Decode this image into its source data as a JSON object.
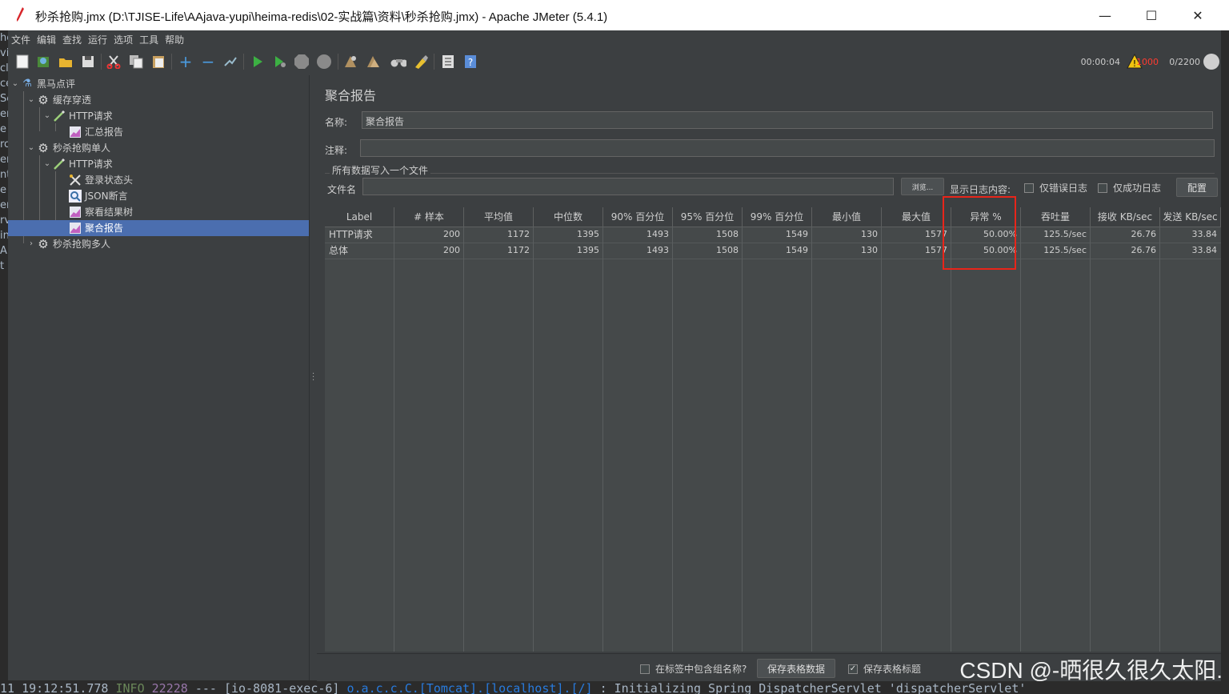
{
  "window": {
    "title": "秒杀抢购.jmx (D:\\TJISE-Life\\AAjava-yupi\\heima-redis\\02-实战篇\\资料\\秒杀抢购.jmx) - Apache JMeter (5.4.1)",
    "minimize": "—",
    "maximize": "☐",
    "close": "✕"
  },
  "menu": [
    "文件",
    "编辑",
    "查找",
    "运行",
    "选项",
    "工具",
    "帮助"
  ],
  "status": {
    "timer": "00:00:04",
    "errors": "1000",
    "threads": "0/2200"
  },
  "tree": {
    "items": [
      {
        "label": "黑马点评"
      },
      {
        "label": "缓存穿透"
      },
      {
        "label": "HTTP请求"
      },
      {
        "label": "汇总报告"
      },
      {
        "label": "秒杀抢购单人"
      },
      {
        "label": "HTTP请求"
      },
      {
        "label": "登录状态头"
      },
      {
        "label": "JSON断言"
      },
      {
        "label": "察看结果树"
      },
      {
        "label": "聚合报告"
      },
      {
        "label": "秒杀抢购多人"
      }
    ]
  },
  "panel": {
    "title": "聚合报告",
    "name_label": "名称:",
    "name_value": "聚合报告",
    "comment_label": "注释:",
    "comment_value": "",
    "file_group": "所有数据写入一个文件",
    "file_label": "文件名",
    "file_value": "",
    "browse": "浏览...",
    "log_label": "显示日志内容:",
    "only_errors": "仅错误日志",
    "only_success": "仅成功日志",
    "config": "配置"
  },
  "table": {
    "headers": [
      "Label",
      "# 样本",
      "平均值",
      "中位数",
      "90% 百分位",
      "95% 百分位",
      "99% 百分位",
      "最小值",
      "最大值",
      "异常 %",
      "吞吐量",
      "接收 KB/sec",
      "发送 KB/sec"
    ],
    "rows": [
      [
        "HTTP请求",
        "200",
        "1172",
        "1395",
        "1493",
        "1508",
        "1549",
        "130",
        "1577",
        "50.00%",
        "125.5/sec",
        "26.76",
        "33.84"
      ],
      [
        "总体",
        "200",
        "1172",
        "1395",
        "1493",
        "1508",
        "1549",
        "130",
        "1577",
        "50.00%",
        "125.5/sec",
        "26.76",
        "33.84"
      ]
    ]
  },
  "footer": {
    "include_group": "在标签中包含组名称?",
    "save_table": "保存表格数据",
    "save_header": "保存表格标题"
  },
  "background": {
    "left_fragments": [
      "he",
      "vi",
      "cl",
      "ce",
      "Se",
      "er",
      "e",
      "ro",
      "er",
      "nt",
      "e",
      "er",
      "rv",
      "in",
      "A",
      "t"
    ],
    "console": {
      "time": "11 19:12:51.778",
      "level": "INFO",
      "pid": "22228",
      "sep": "---",
      "thread": "[io-8081-exec-6]",
      "logger": "o.a.c.c.C.[Tomcat].[localhost].[/]",
      "message": ": Initializing Spring DispatcherServlet 'dispatcherServlet'"
    }
  },
  "watermark": "CSDN @-晒很久很久太阳."
}
